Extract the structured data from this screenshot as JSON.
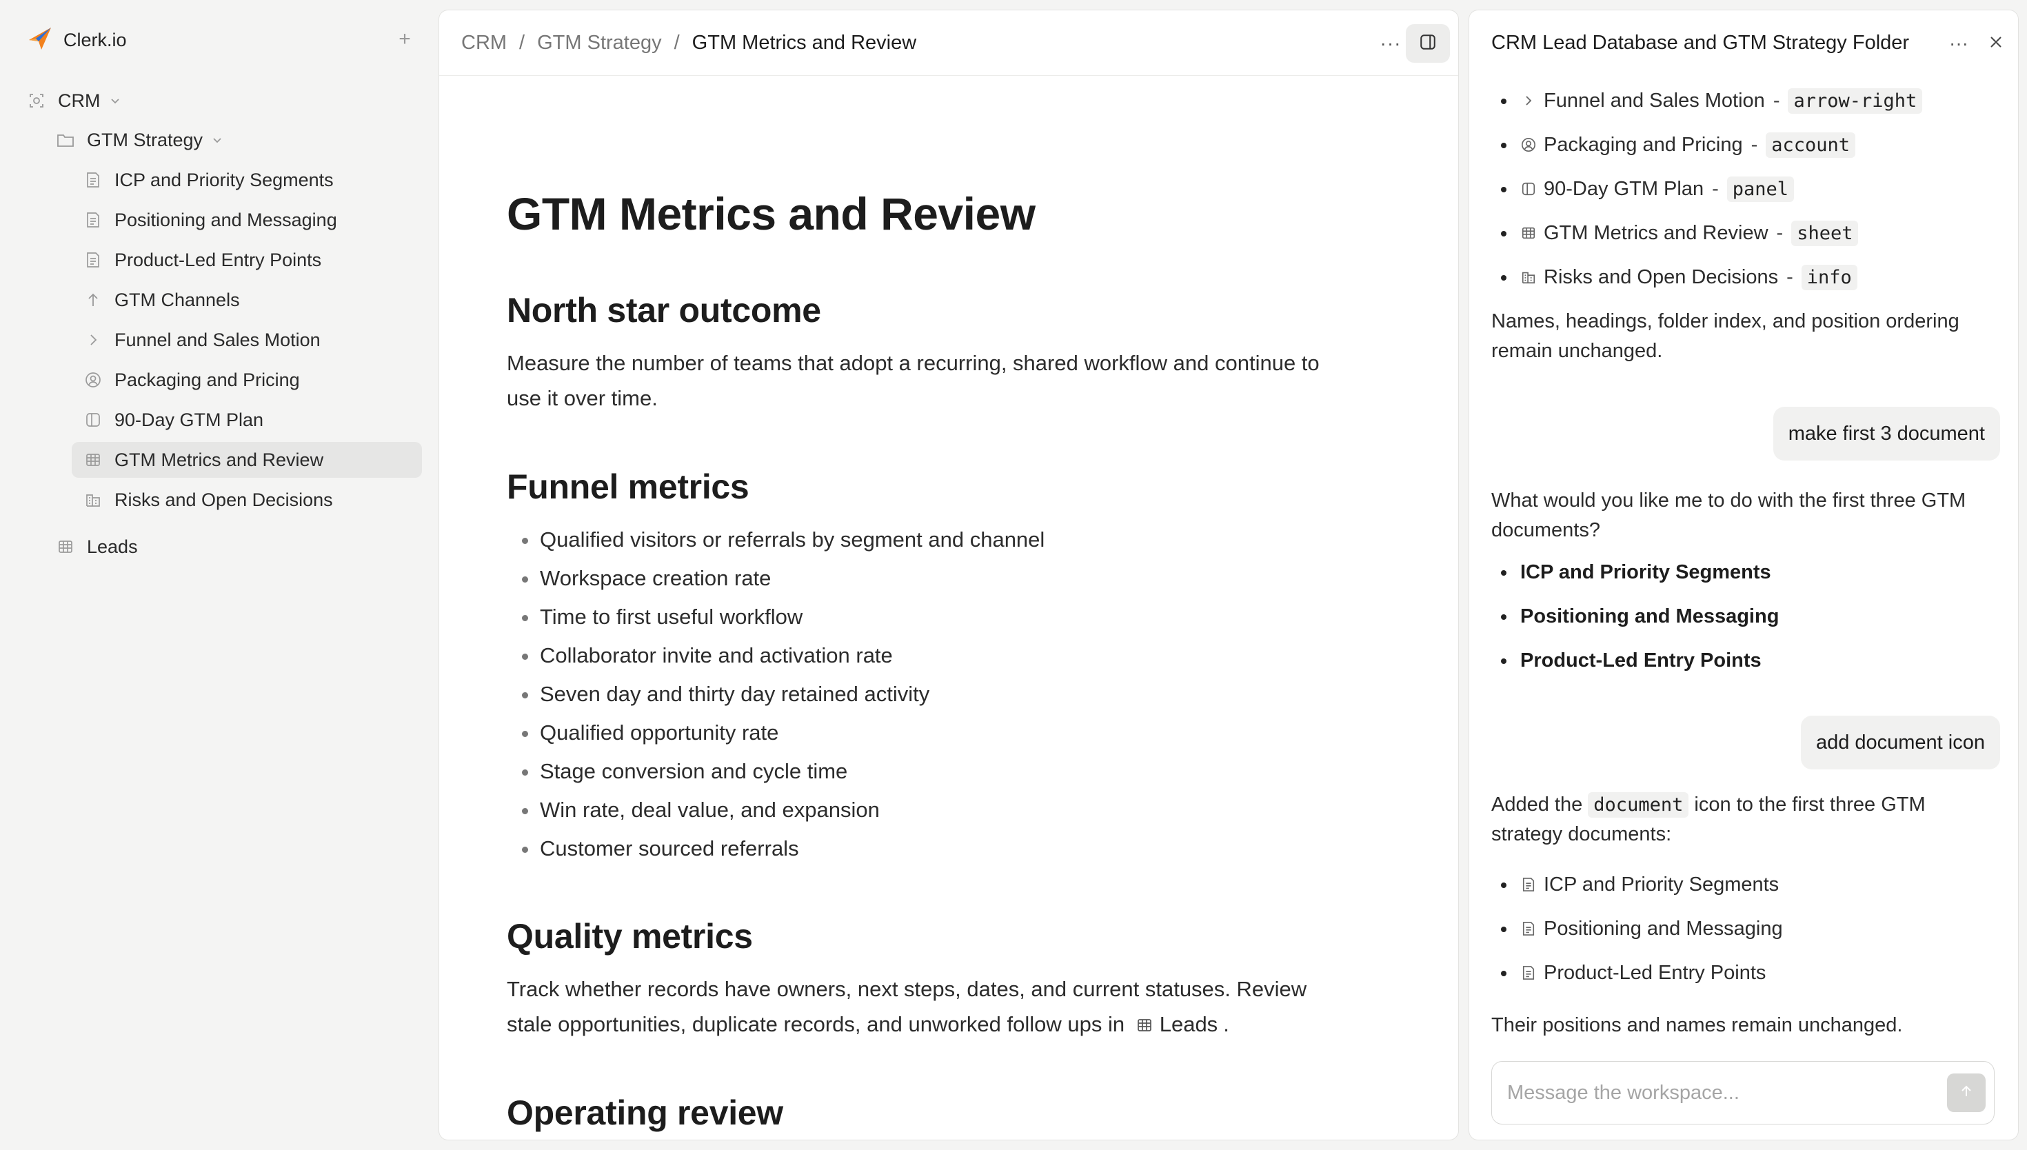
{
  "colors": {
    "sidebar_bg": "#f4f4f3",
    "panel_bg": "#ffffff",
    "active_row": "#e6e6e5",
    "brand_orange": "#f2811d",
    "brand_blue": "#2f6fd6"
  },
  "sidebar": {
    "app_name": "Clerk.io",
    "add_label": "+",
    "tree": [
      {
        "label": "CRM",
        "icon": "crm-icon",
        "expanded": true
      },
      {
        "label": "GTM Strategy",
        "icon": "folder-icon",
        "expanded": true
      },
      {
        "label": "ICP and Priority Segments",
        "icon": "document-icon"
      },
      {
        "label": "Positioning and Messaging",
        "icon": "document-icon"
      },
      {
        "label": "Product-Led Entry Points",
        "icon": "document-icon"
      },
      {
        "label": "GTM Channels",
        "icon": "arrow-up-icon"
      },
      {
        "label": "Funnel and Sales Motion",
        "icon": "arrow-right-icon"
      },
      {
        "label": "Packaging and Pricing",
        "icon": "account-icon"
      },
      {
        "label": "90-Day GTM Plan",
        "icon": "panel-icon"
      },
      {
        "label": "GTM Metrics and Review",
        "icon": "sheet-icon",
        "active": true
      },
      {
        "label": "Risks and Open Decisions",
        "icon": "info-icon"
      },
      {
        "label": "Leads",
        "icon": "sheet-icon"
      }
    ]
  },
  "document": {
    "breadcrumbs": [
      "CRM",
      "GTM Strategy",
      "GTM Metrics and Review"
    ],
    "separator": "/",
    "more_label": "···",
    "title": "GTM Metrics and Review",
    "north_star": {
      "heading": "North star outcome",
      "text": "Measure the number of teams that adopt a recurring, shared workflow and continue to use it over time."
    },
    "funnel": {
      "heading": "Funnel metrics",
      "items": [
        "Qualified visitors or referrals by segment and channel",
        "Workspace creation rate",
        "Time to first useful workflow",
        "Collaborator invite and activation rate",
        "Seven day and thirty day retained activity",
        "Qualified opportunity rate",
        "Stage conversion and cycle time",
        "Win rate, deal value, and expansion",
        "Customer sourced referrals"
      ]
    },
    "quality": {
      "heading": "Quality metrics",
      "text_before": "Track whether records have owners, next steps, dates, and current statuses. Review stale opportunities, duplicate records, and unworked follow ups in",
      "link_label": "Leads",
      "text_after": "."
    },
    "operating": {
      "heading": "Operating review"
    }
  },
  "chat": {
    "title": "CRM Lead Database and GTM Strategy Folder",
    "more_label": "···",
    "icon_list": [
      {
        "name": "Funnel and Sales Motion",
        "code": "arrow-right",
        "icon": "arrow-right-icon"
      },
      {
        "name": "Packaging and Pricing",
        "code": "account",
        "icon": "account-icon"
      },
      {
        "name": "90-Day GTM Plan",
        "code": "panel",
        "icon": "panel-icon"
      },
      {
        "name": "GTM Metrics and Review",
        "code": "sheet",
        "icon": "sheet-icon"
      },
      {
        "name": "Risks and Open Decisions",
        "code": "info",
        "icon": "info-icon"
      }
    ],
    "dash": "-",
    "note_1": "Names, headings, folder index, and position ordering remain unchanged.",
    "user_msg_1": "make first 3 document",
    "reply_1": "What would you like me to do with the first three GTM documents?",
    "reply_1_items": [
      "ICP and Priority Segments",
      "Positioning and Messaging",
      "Product-Led Entry Points"
    ],
    "user_msg_2": "add document icon",
    "reply_2_before": "Added the",
    "reply_2_code": "document",
    "reply_2_after": "icon to the first three GTM strategy documents:",
    "reply_2_items": [
      "ICP and Priority Segments",
      "Positioning and Messaging",
      "Product-Led Entry Points"
    ],
    "note_2": "Their positions and names remain unchanged.",
    "input_placeholder": "Message the workspace..."
  }
}
